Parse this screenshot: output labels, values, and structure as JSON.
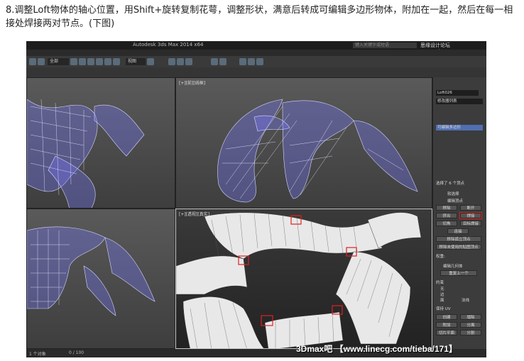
{
  "caption": "8.调整Loft物体的轴心位置，用Shift+旋转复制花萼，调整形状，满意后转成可编辑多边形物体，附加在一起，然后在每一相接处焊接两对节点。(下图)",
  "app": {
    "title": "Autodesk 3ds Max 2014 x64",
    "search_placeholder": "键入关键字或短语",
    "site_watermark": "思缘设计论坛 www.missyuan.com"
  },
  "toolbar": {
    "selection_set": "全部",
    "view_dropdown": "视图"
  },
  "viewports": {
    "top_right_label": "[+][前][线框]",
    "bottom_right_label": "[+][透视][真实]"
  },
  "command_panel": {
    "object_name": "Loft026",
    "modifier_list": "修改器列表",
    "stack_item": "可编辑多边形",
    "selection_info": "选择了 6 个顶点",
    "rollout_select": "软选择",
    "rollout_edit_vertices": "编辑顶点",
    "remove_btn": "移除",
    "break_btn": "断开",
    "extrude_btn": "挤出",
    "weld_btn": "焊接",
    "chamfer_btn": "切角",
    "target_weld_btn": "目标焊接",
    "connect_btn": "连接",
    "remove_isolated": "移除孤立顶点",
    "remove_unused": "移除未使用的贴图顶点",
    "weight_label": "权重:",
    "rollout_edit_geometry": "编辑几何体",
    "repeat_last": "重复上一个",
    "constraints": "约束",
    "none": "无",
    "edge": "边",
    "face": "面",
    "normal": "法线",
    "preserve_uvs": "保持 UV",
    "create": "创建",
    "collapse": "塌陷",
    "attach": "附加",
    "detach": "分离",
    "slice_plane": "切片平面",
    "split": "分割"
  },
  "status": {
    "left": "1 个对象",
    "frame": "0 / 100"
  },
  "watermark": {
    "brand": "3Dmax吧",
    "url": "【www.linecg.com/tieba/171】"
  }
}
